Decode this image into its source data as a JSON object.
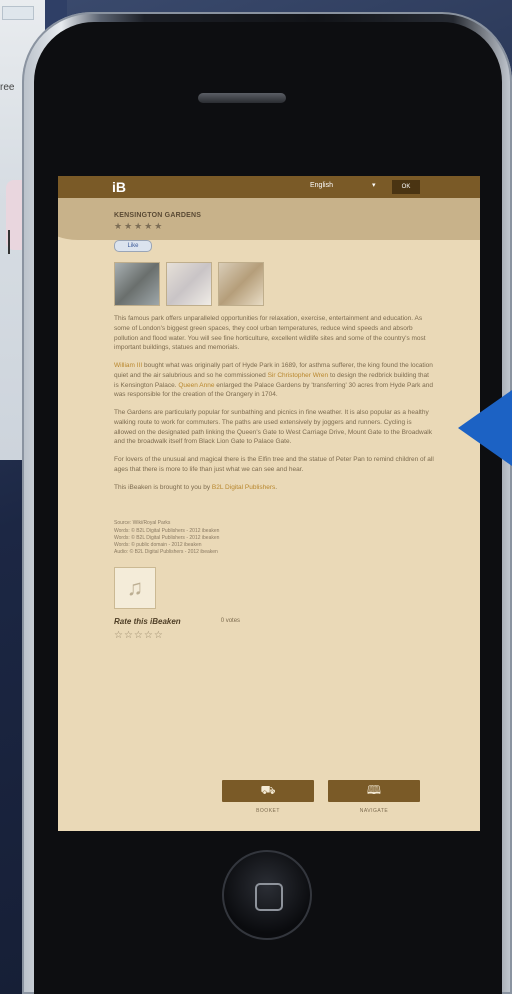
{
  "background": {
    "map_label": "ree"
  },
  "app": {
    "logo": "iB",
    "language": "English",
    "language_arrow": "▾",
    "top_button": "OK",
    "place_title": "KENSINGTON GARDENS",
    "rating_stars": "★★★★★",
    "like_label": "Like"
  },
  "article": {
    "para1": "This famous park offers unparalleled opportunities for relaxation, exercise, entertainment and education. As some of London's biggest green spaces, they cool urban temperatures, reduce wind speeds and absorb pollution and flood water. You will see fine horticulture, excellent wildlife sites and some of the country's most important buildings, statues and memorials.",
    "para2_link1": "William III",
    "para2_mid": " bought what was originally part of Hyde Park in 1689, for asthma sufferer, the king found the location quiet and the air salubrious and so he commissioned ",
    "para2_link2": "Sir Christopher Wren",
    "para2_mid2": " to design the redbrick building that is Kensington Palace. ",
    "para2_link3": "Queen Anne",
    "para2_end": " enlarged the Palace Gardens by 'transferring' 30 acres from Hyde Park and was responsible for the creation of the Orangery in 1704.",
    "para3": "The Gardens are particularly popular for sunbathing and picnics in fine weather. It is also popular as a healthy walking route to work for commuters. The paths are used extensively by joggers and runners. Cycling is allowed on the designated path linking the Queen's Gate to West Carriage Drive, Mount Gate to the Broadwalk and the broadwalk itself from Black Lion Gate to Palace Gate.",
    "para4": "For lovers of the unusual and magical there is the Elfin tree and the statue of Peter Pan to remind children of all ages that there is more to life than just what we can see and hear.",
    "para5_start": "This iBeaken is brought to you by ",
    "para5_link": "B2L Digital Publishers",
    "para5_end": "."
  },
  "credits": [
    "Source: Wiki/Royal Parks",
    "Words: © B2L Digital Publishers - 2012 ibeaken",
    "Words: © B2L Digital Publishers - 2012 ibeaken",
    "Words: © public domain - 2012 ibeaken",
    "Audio: © B2L Digital Publishers - 2012 ibeaken"
  ],
  "media": {
    "music_icon": "♫"
  },
  "rating": {
    "label": "Rate this iBeaken",
    "votes": "0 votes",
    "stars": "☆☆☆☆☆"
  },
  "buttons": [
    {
      "icon": "⛟",
      "label": "BOOKET"
    },
    {
      "icon": "🕮",
      "label": "NAVIGATE"
    }
  ],
  "colors": {
    "accent": "#7a5a27",
    "screen_bg": "#ead9b7",
    "arrow": "#1c62c4"
  }
}
